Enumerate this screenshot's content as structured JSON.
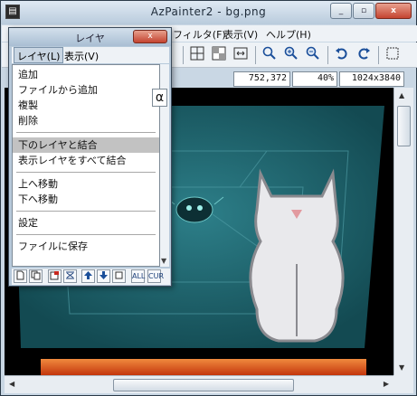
{
  "window": {
    "title": "AzPainter2 - bg.png",
    "minimize_label": "_",
    "maximize_label": "▫",
    "close_label": "x"
  },
  "menubar": {
    "filter_label": "フィルタ(F)",
    "view_label": "表示(V)",
    "help_label": "ヘルプ(H)"
  },
  "toolbar": {
    "icons": [
      "grid-icon",
      "checker-icon",
      "fit-width-icon",
      "zoom-fit-icon",
      "zoom-in-icon",
      "zoom-out-icon",
      "undo-icon",
      "redo-icon"
    ]
  },
  "status": {
    "coordinates": "752,372",
    "zoom": "40%",
    "image_size": "1024x3840"
  },
  "layer_panel": {
    "title": "レイヤ",
    "close_label": "x",
    "menu_layer": "レイヤ(L)",
    "menu_view": "表示(V)",
    "alpha_label": "α",
    "dropdown": {
      "add": "追加",
      "add_from_file": "ファイルから追加",
      "duplicate": "複製",
      "delete": "削除",
      "merge_down": "下のレイヤと結合",
      "merge_visible": "表示レイヤをすべて結合",
      "move_up": "上へ移動",
      "move_down": "下へ移動",
      "settings": "設定",
      "save_to_file": "ファイルに保存"
    },
    "bottom_toolbar": {
      "all_label": "ALL",
      "cur_label": "CUR"
    }
  },
  "colors": {
    "canvas_teal": "#1b5c66",
    "canvas_bg": "#000000",
    "highlight": "#c2c2c2",
    "floor_orange": "#d8501a"
  }
}
